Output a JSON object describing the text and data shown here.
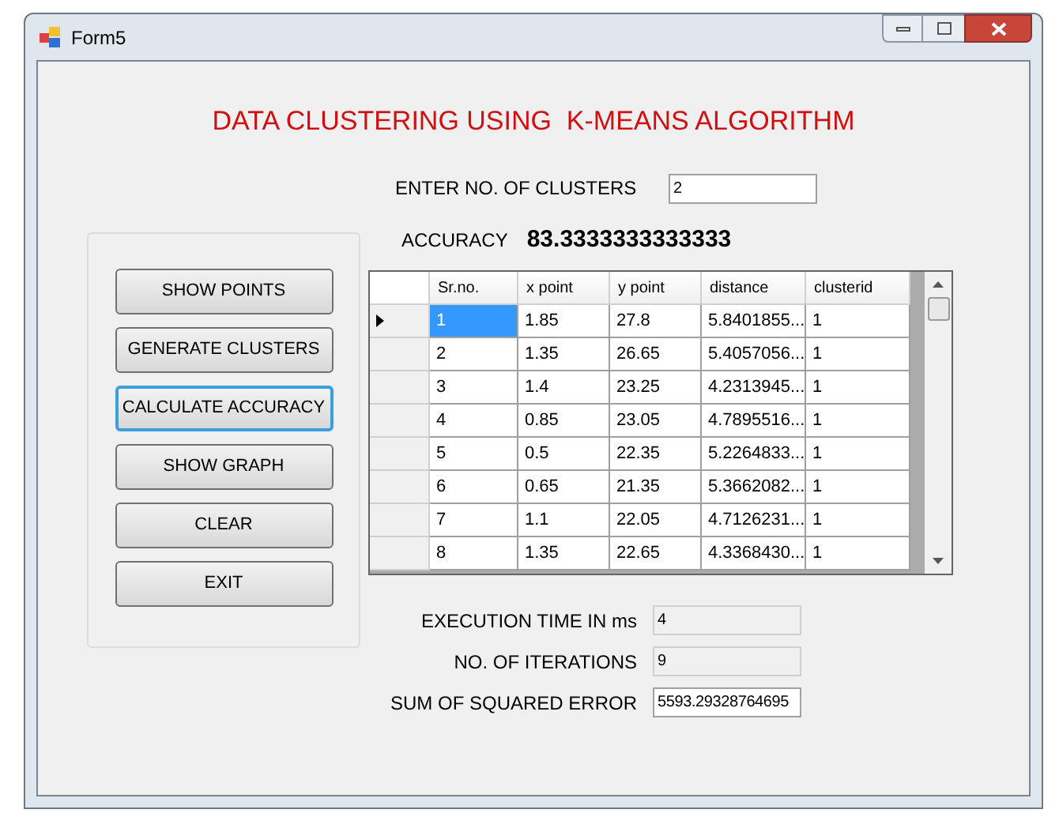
{
  "window": {
    "title": "Form5"
  },
  "heading": "DATA CLUSTERING USING  K-MEANS ALGORITHM",
  "clusters": {
    "label": "ENTER NO. OF CLUSTERS",
    "value": "2",
    "readonly": false
  },
  "accuracy": {
    "label": "ACCURACY",
    "value": "83.3333333333333"
  },
  "buttons": [
    {
      "label": "SHOW POINTS",
      "focused": false
    },
    {
      "label": "GENERATE CLUSTERS",
      "focused": false
    },
    {
      "label": "CALCULATE ACCURACY",
      "focused": true
    },
    {
      "label": "SHOW GRAPH",
      "focused": false
    },
    {
      "label": "CLEAR",
      "focused": false
    },
    {
      "label": "EXIT",
      "focused": false
    }
  ],
  "table": {
    "columns": [
      "Sr.no.",
      "x point",
      "y point",
      "distance",
      "clusterid"
    ],
    "rows": [
      {
        "cells": [
          "1",
          "1.85",
          "27.8",
          "5.8401855...",
          "1"
        ],
        "selected": true
      },
      {
        "cells": [
          "2",
          "1.35",
          "26.65",
          "5.4057056...",
          "1"
        ],
        "selected": false
      },
      {
        "cells": [
          "3",
          "1.4",
          "23.25",
          "4.2313945...",
          "1"
        ],
        "selected": false
      },
      {
        "cells": [
          "4",
          "0.85",
          "23.05",
          "4.7895516...",
          "1"
        ],
        "selected": false
      },
      {
        "cells": [
          "5",
          "0.5",
          "22.35",
          "5.2264833...",
          "1"
        ],
        "selected": false
      },
      {
        "cells": [
          "6",
          "0.65",
          "21.35",
          "5.3662082...",
          "1"
        ],
        "selected": false
      },
      {
        "cells": [
          "7",
          "1.1",
          "22.05",
          "4.7126231...",
          "1"
        ],
        "selected": false
      },
      {
        "cells": [
          "8",
          "1.35",
          "22.65",
          "4.3368430...",
          "1"
        ],
        "selected": false
      }
    ]
  },
  "results": [
    {
      "label": "EXECUTION TIME IN ms",
      "value": "4",
      "readonly": true
    },
    {
      "label": "NO. OF ITERATIONS",
      "value": "9",
      "readonly": true
    },
    {
      "label": "SUM OF SQUARED ERROR",
      "value": "5593.29328764695",
      "readonly": false
    }
  ]
}
